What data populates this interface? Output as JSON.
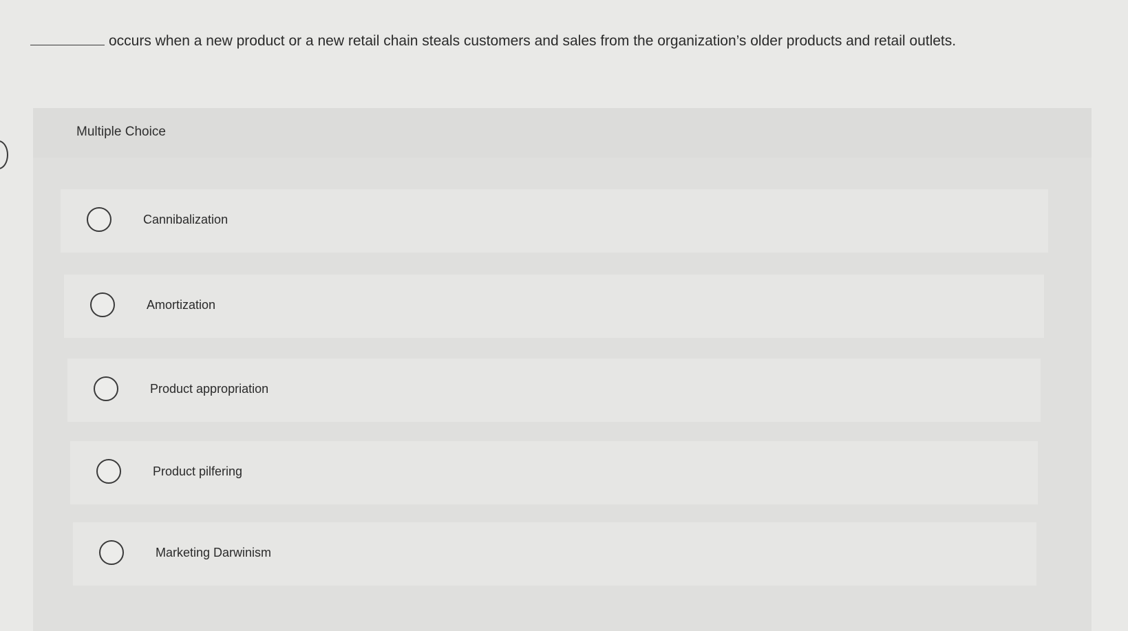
{
  "question": {
    "text": "occurs when a new product or a new retail chain steals customers and sales from the organization’s older products and retail outlets."
  },
  "multiple_choice": {
    "title": "Multiple Choice",
    "options": [
      {
        "label": "Cannibalization"
      },
      {
        "label": "Amortization"
      },
      {
        "label": "Product appropriation"
      },
      {
        "label": "Product pilfering"
      },
      {
        "label": "Marketing Darwinism"
      }
    ]
  }
}
